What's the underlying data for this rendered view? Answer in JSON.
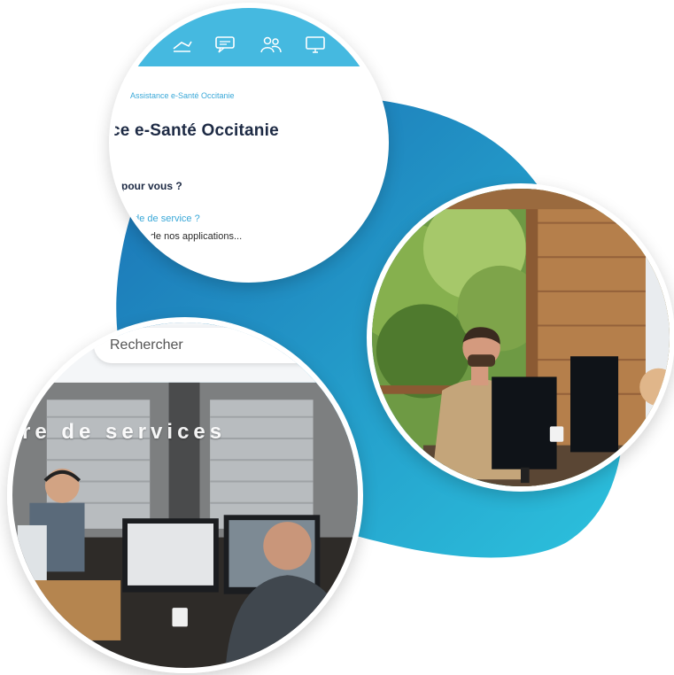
{
  "colors": {
    "accent": "#45b9e0",
    "blob_dark": "#1a6fb3",
    "blob_light": "#2cc2dd",
    "heading": "#1d2a44"
  },
  "website": {
    "icons": [
      "hand-icon",
      "chat-icon",
      "people-icon",
      "monitor-icon"
    ],
    "breadcrumb": "Assistance e-Santé Occitanie",
    "title": "ce e-Santé Occitanie",
    "question": "e pour vous ?",
    "link": "nde de service ?",
    "line": "tion de nos applications..."
  },
  "office": {
    "search_placeholder": "Rechercher",
    "banner": "tre de services"
  }
}
